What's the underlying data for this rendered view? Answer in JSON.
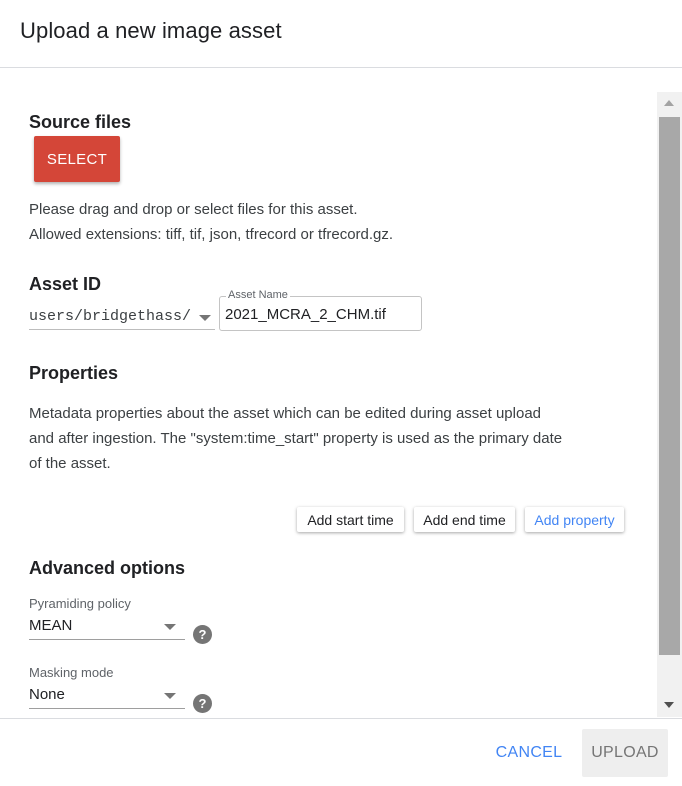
{
  "dialog": {
    "title": "Upload a new image asset"
  },
  "source_files": {
    "title": "Source files",
    "select_label": "SELECT",
    "help_line1": "Please drag and drop or select files for this asset.",
    "help_line2": "Allowed extensions: tiff, tif, json, tfrecord or tfrecord.gz."
  },
  "asset_id": {
    "title": "Asset ID",
    "prefix": "users/bridgethass/",
    "name_label": "Asset Name",
    "name_value": "2021_MCRA_2_CHM.tif"
  },
  "properties": {
    "title": "Properties",
    "description_line1": "Metadata properties about the asset which can be edited during asset upload",
    "description_line2": "and after ingestion. The \"system:time_start\" property is used as the primary date",
    "description_line3": "of the asset.",
    "add_start_time": "Add start time",
    "add_end_time": "Add end time",
    "add_property": "Add property",
    "link_color": "#4285f4"
  },
  "advanced": {
    "title": "Advanced options",
    "pyramiding_label": "Pyramiding policy",
    "pyramiding_value": "MEAN",
    "masking_label": "Masking mode",
    "masking_value": "None",
    "help_icon_glyph": "?"
  },
  "footer": {
    "cancel_label": "CANCEL",
    "upload_label": "UPLOAD"
  },
  "colors": {
    "select_button": "#d44638",
    "accent": "#4285f4"
  },
  "scroll_position": 0
}
